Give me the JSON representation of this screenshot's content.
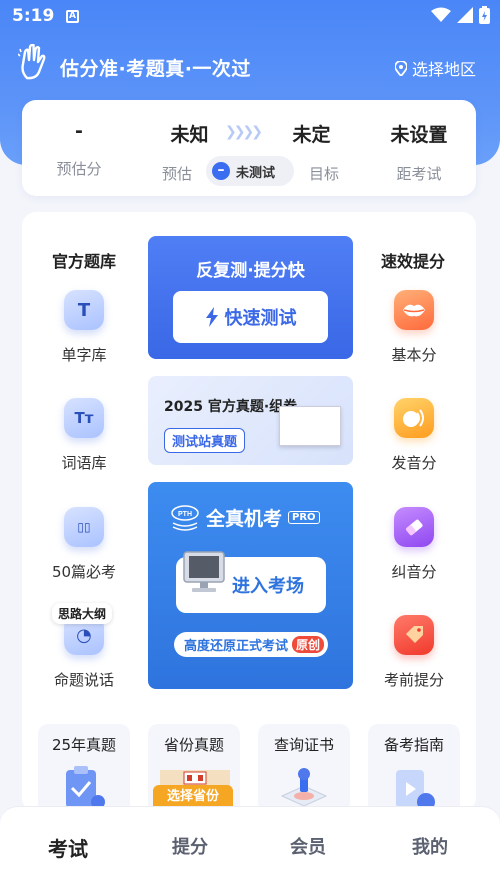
{
  "status_bar": {
    "time": "5:19",
    "notification_icon": "A"
  },
  "header": {
    "slogan": "估分准·考题真·一次过",
    "region_label": "选择地区"
  },
  "score_card": {
    "estimated_value": "-",
    "estimated_label": "预估分",
    "predict_value": "未知",
    "predict_label": "预估",
    "untested_label": "未测试",
    "target_value": "未定",
    "target_label": "目标",
    "countdown_value": "未设置",
    "countdown_label": "距考试"
  },
  "left_column": {
    "title": "官方题库",
    "items": [
      {
        "label": "单字库",
        "glyph": "T"
      },
      {
        "label": "词语库",
        "glyph": "Tт"
      },
      {
        "label": "50篇必考",
        "glyph": "▯▯"
      },
      {
        "label": "命题说话",
        "glyph": "◔",
        "tag": "思路大纲"
      }
    ]
  },
  "right_column": {
    "title": "速效提分",
    "items": [
      {
        "label": "基本分"
      },
      {
        "label": "发音分"
      },
      {
        "label": "纠音分"
      },
      {
        "label": "考前提分"
      }
    ]
  },
  "banner_quick": {
    "title": "反复测·提分快",
    "button": "快速测试"
  },
  "banner_paper": {
    "title": "2025 官方真题·组卷",
    "chip": "测试站真题"
  },
  "banner_mock": {
    "brand": "全真机考",
    "badge": "PRO",
    "logo_text": "PTH",
    "button": "进入考场",
    "tagline": "高度还原正式考试",
    "tagline_badge": "原创"
  },
  "shortcuts": [
    {
      "label": "25年真题"
    },
    {
      "label": "省份真题",
      "badge": "选择省份"
    },
    {
      "label": "查询证书"
    },
    {
      "label": "备考指南"
    }
  ],
  "bottom_nav": [
    {
      "label": "考试",
      "active": true
    },
    {
      "label": "提分",
      "active": false
    },
    {
      "label": "会员",
      "active": false
    },
    {
      "label": "我的",
      "active": false
    }
  ],
  "colors": {
    "primary": "#3a68e6",
    "accent_orange": "#f5a623",
    "accent_red": "#f04a3a"
  }
}
